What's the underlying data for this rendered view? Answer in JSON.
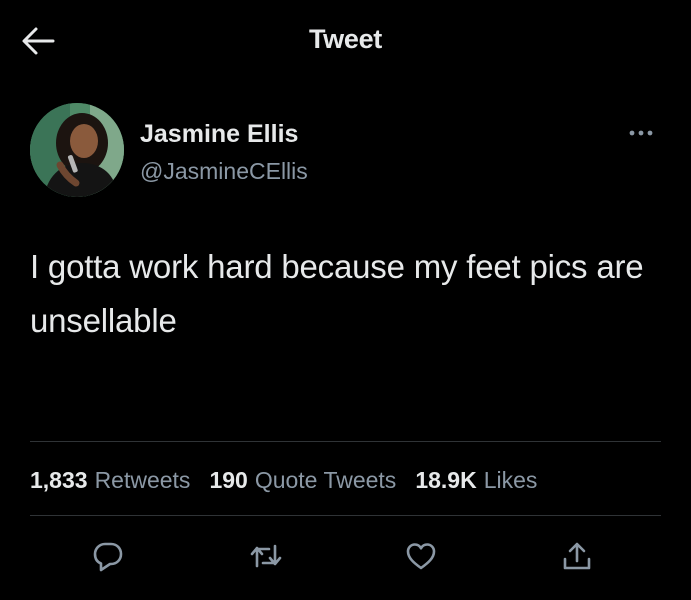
{
  "header": {
    "title": "Tweet",
    "back_icon": "arrow-left-icon"
  },
  "author": {
    "display_name": "Jasmine Ellis",
    "handle": "@JasmineCEllis",
    "avatar_icon": "user-avatar"
  },
  "more_icon": "more-horizontal-icon",
  "tweet": {
    "text": "I gotta work hard because my feet pics are unsellable"
  },
  "stats": {
    "retweets_count": "1,833",
    "retweets_label": "Retweets",
    "quotes_count": "190",
    "quotes_label": "Quote Tweets",
    "likes_count": "18.9K",
    "likes_label": "Likes"
  },
  "actions": {
    "reply_icon": "reply-icon",
    "retweet_icon": "retweet-icon",
    "like_icon": "heart-icon",
    "share_icon": "share-icon"
  },
  "colors": {
    "background": "#000000",
    "text_primary": "#e7e9ea",
    "text_secondary": "#8b98a5",
    "divider": "#2f3336"
  }
}
